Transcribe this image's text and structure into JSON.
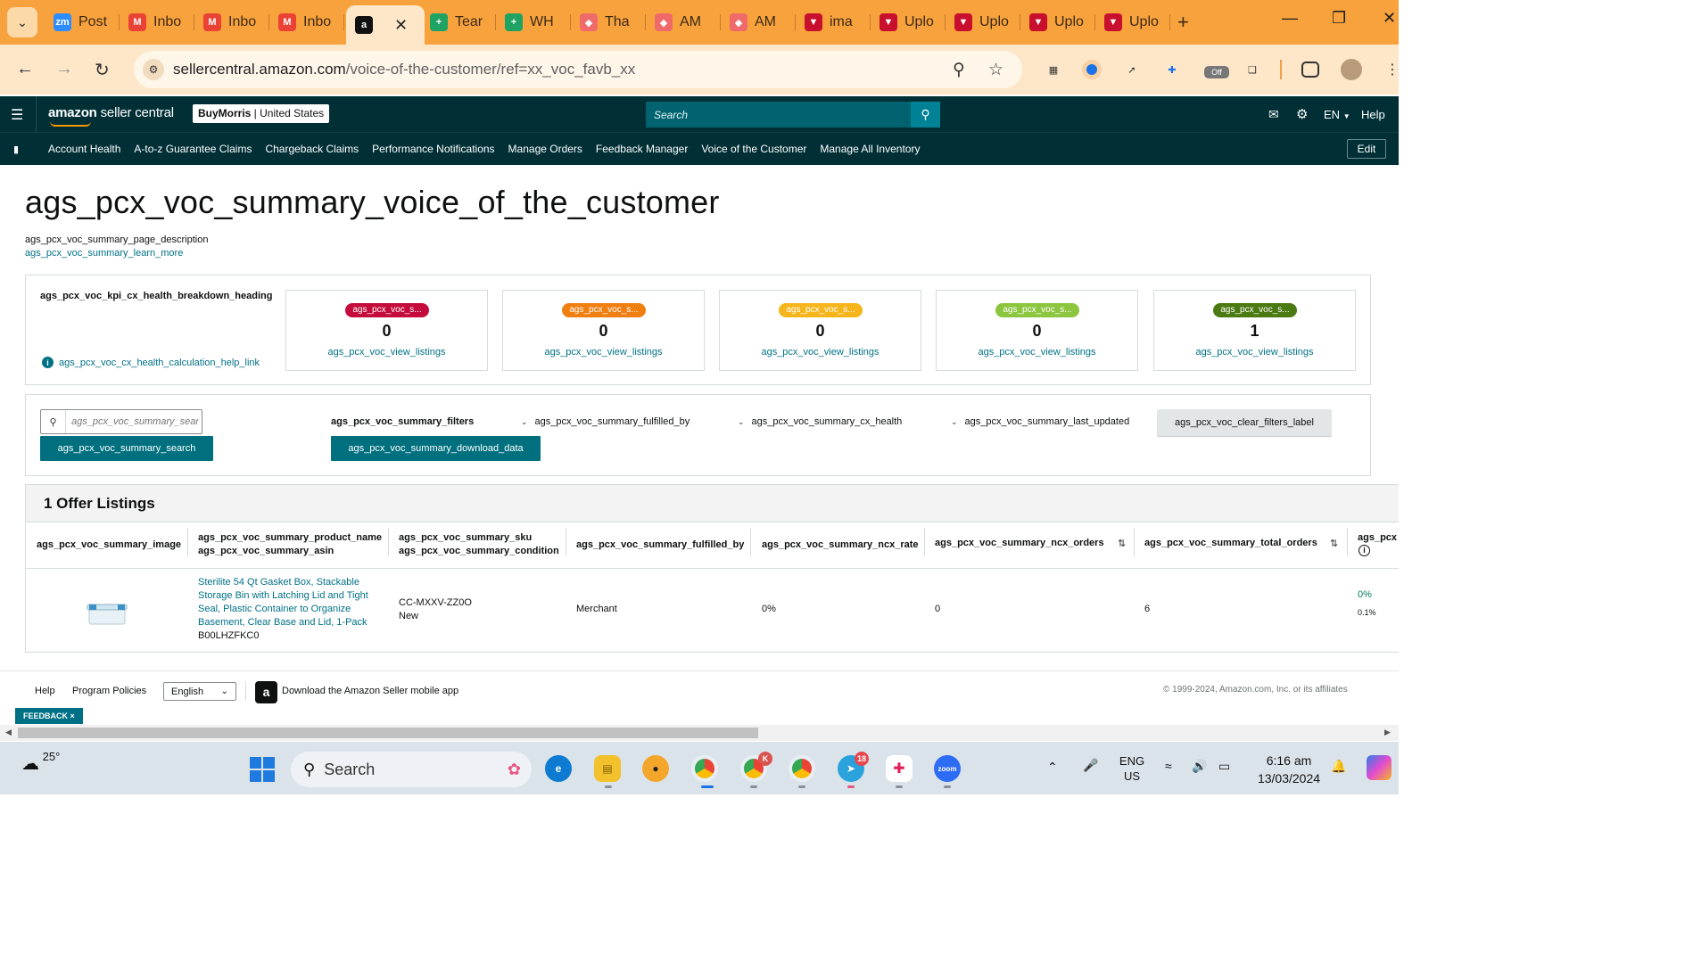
{
  "browser": {
    "tabs": [
      {
        "label": "Post",
        "icon": "zoom-icon",
        "color": "#2d8cff",
        "glyph": "zm"
      },
      {
        "label": "Inbo",
        "icon": "gmail-icon",
        "color": "#ea4335",
        "glyph": "M"
      },
      {
        "label": "Inbo",
        "icon": "gmail-icon",
        "color": "#ea4335",
        "glyph": "M"
      },
      {
        "label": "Inbo",
        "icon": "gmail-icon",
        "color": "#ea4335",
        "glyph": "M"
      },
      {
        "label": "",
        "icon": "amazon-icon",
        "color": "#111111",
        "glyph": "a",
        "active": true
      },
      {
        "label": "Tear",
        "icon": "sheets-icon",
        "color": "#1ea362",
        "glyph": "+"
      },
      {
        "label": "WH",
        "icon": "sheets-icon",
        "color": "#1ea362",
        "glyph": "+"
      },
      {
        "label": "Tha",
        "icon": "asana-icon",
        "color": "#f06a6a",
        "glyph": "◆"
      },
      {
        "label": "AM",
        "icon": "asana-icon",
        "color": "#f06a6a",
        "glyph": "◆"
      },
      {
        "label": "AM",
        "icon": "asana-icon",
        "color": "#f06a6a",
        "glyph": "◆"
      },
      {
        "label": "ima",
        "icon": "upload-tool-icon",
        "color": "#c8102e",
        "glyph": "▼"
      },
      {
        "label": "Uplo",
        "icon": "upload-tool-icon",
        "color": "#c8102e",
        "glyph": "▼"
      },
      {
        "label": "Uplo",
        "icon": "upload-tool-icon",
        "color": "#c8102e",
        "glyph": "▼"
      },
      {
        "label": "Uplo",
        "icon": "upload-tool-icon",
        "color": "#c8102e",
        "glyph": "▼"
      },
      {
        "label": "Uplo",
        "icon": "upload-tool-icon",
        "color": "#c8102e",
        "glyph": "▼"
      }
    ],
    "url_host": "sellercentral.amazon.com",
    "url_path": "/voice-of-the-customer/ref=xx_voc_favb_xx",
    "extension_badge": "Off"
  },
  "header": {
    "brand": "amazon",
    "brand_suffix": "seller central",
    "account_name": "BuyMorris",
    "account_region": "United States",
    "search_placeholder": "Search",
    "language": "EN",
    "help": "Help"
  },
  "nav": {
    "items": [
      "Account Health",
      "A-to-z Guarantee Claims",
      "Chargeback Claims",
      "Performance Notifications",
      "Manage Orders",
      "Feedback Manager",
      "Voice of the Customer",
      "Manage All Inventory"
    ],
    "edit": "Edit"
  },
  "page": {
    "title": "ags_pcx_voc_summary_voice_of_the_customer",
    "description": "ags_pcx_voc_summary_page_description",
    "learn_more": "ags_pcx_voc_summary_learn_more"
  },
  "kpi": {
    "heading": "ags_pcx_voc_kpi_cx_health_breakdown_heading",
    "help_link": "ags_pcx_voc_cx_health_calculation_help_link",
    "cards": [
      {
        "pill": "ags_pcx_voc_s...",
        "color": "#c40b3c",
        "count": "0",
        "link": "ags_pcx_voc_view_listings"
      },
      {
        "pill": "ags_pcx_voc_s...",
        "color": "#f07f12",
        "count": "0",
        "link": "ags_pcx_voc_view_listings"
      },
      {
        "pill": "ags_pcx_voc_s...",
        "color": "#f5b51b",
        "count": "0",
        "link": "ags_pcx_voc_view_listings"
      },
      {
        "pill": "ags_pcx_voc_s...",
        "color": "#8cc63f",
        "count": "0",
        "link": "ags_pcx_voc_view_listings"
      },
      {
        "pill": "ags_pcx_voc_s...",
        "color": "#4b7a13",
        "count": "1",
        "link": "ags_pcx_voc_view_listings"
      }
    ]
  },
  "filters": {
    "search_placeholder": "ags_pcx_voc_summary_sear",
    "search_button": "ags_pcx_voc_summary_search",
    "filters_label": "ags_pcx_voc_summary_filters",
    "download_button": "ags_pcx_voc_summary_download_data",
    "dropdowns": [
      "ags_pcx_voc_summary_fulfilled_by",
      "ags_pcx_voc_summary_cx_health",
      "ags_pcx_voc_summary_last_updated"
    ],
    "clear_button": "ags_pcx_voc_clear_filters_label"
  },
  "table": {
    "title": "1 Offer Listings",
    "headers": {
      "image": "ags_pcx_voc_summary_image",
      "product_name": "ags_pcx_voc_summary_product_name",
      "asin": "ags_pcx_voc_summary_asin",
      "sku": "ags_pcx_voc_summary_sku",
      "condition": "ags_pcx_voc_summary_condition",
      "fulfilled_by": "ags_pcx_voc_summary_fulfilled_by",
      "ncx_rate": "ags_pcx_voc_summary_ncx_rate",
      "ncx_orders": "ags_pcx_voc_summary_ncx_orders",
      "total_orders": "ags_pcx_voc_summary_total_orders",
      "truncated": "ags_pcx"
    },
    "rows": [
      {
        "product_name_lines": [
          "Sterilite 54 Qt Gasket Box, Stackable",
          "Storage Bin with Latching Lid and Tight",
          "Seal, Plastic Container to Organize",
          "Basement, Clear Base and Lid, 1-Pack"
        ],
        "asin": "B00LHZFKC0",
        "sku": "CC-MXXV-ZZ0O",
        "condition": "New",
        "fulfilled_by": "Merchant",
        "ncx_rate": "0%",
        "ncx_orders": "0",
        "total_orders": "6",
        "extra_value": "0%",
        "extra_sub": "0.1%"
      }
    ]
  },
  "footer": {
    "help": "Help",
    "program_policies": "Program Policies",
    "language": "English",
    "app_promo": "Download the Amazon Seller mobile app",
    "copyright": "© 1999-2024, Amazon.com, Inc. or its affiliates",
    "feedback": "FEEDBACK ×"
  },
  "taskbar": {
    "temperature": "25°",
    "search": "Search",
    "telegram_badge": "18",
    "lang_line1": "ENG",
    "lang_line2": "US",
    "time": "6:16 am",
    "date": "13/03/2024",
    "badge_k": "K"
  },
  "colors": {
    "header_bg": "#002f36",
    "link": "#007185",
    "button_teal": "#00707f",
    "browser_orange": "#f8a23e"
  }
}
